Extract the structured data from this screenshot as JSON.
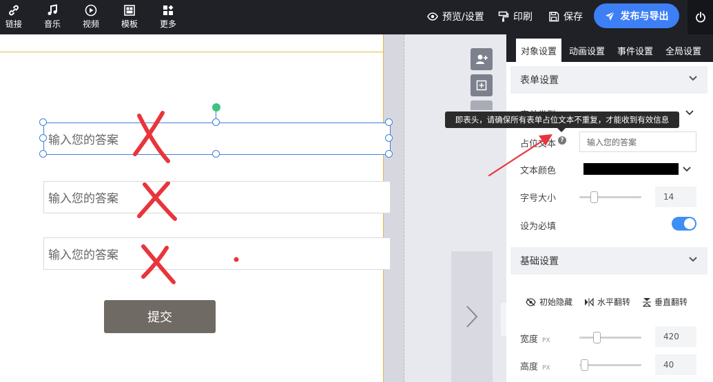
{
  "toolbar": {
    "tools": [
      {
        "label": "链接",
        "icon": "link-icon"
      },
      {
        "label": "音乐",
        "icon": "music-icon"
      },
      {
        "label": "视频",
        "icon": "video-icon"
      },
      {
        "label": "模板",
        "icon": "template-icon"
      },
      {
        "label": "更多",
        "icon": "more-icon"
      }
    ],
    "preview_label": "预览/设置",
    "print_label": "印刷",
    "save_label": "保存",
    "publish_label": "发布与导出"
  },
  "canvas": {
    "fields": [
      {
        "placeholder": "输入您的答案"
      },
      {
        "placeholder": "输入您的答案"
      },
      {
        "placeholder": "输入您的答案"
      }
    ],
    "submit_label": "提交"
  },
  "panel": {
    "tabs": [
      "对象设置",
      "动画设置",
      "事件设置",
      "全局设置"
    ],
    "form_section": {
      "title": "表单设置",
      "type_label": "表单类型",
      "placeholder_label": "占位文本",
      "placeholder_value": "输入您的答案",
      "text_color_label": "文本颜色",
      "text_color": "#000000",
      "font_size_label": "字号大小",
      "font_size_value": "14",
      "required_label": "设为必填",
      "required": true
    },
    "basic_section": {
      "title": "基础设置",
      "hide_label": "初始隐藏",
      "hflip_label": "水平翻转",
      "vflip_label": "垂直翻转",
      "width_label": "宽度",
      "width_unit": "PX",
      "width_value": "420",
      "height_label": "高度",
      "height_unit": "PX",
      "height_value": "40"
    }
  },
  "tooltip": "即表头，请确保所有表单占位文本不重复，才能收到有效信息",
  "colors": {
    "accent": "#3d7ff5",
    "toolbar_bg": "#1f2127",
    "annotation_red": "#e8353b",
    "selection_blue": "#3f7fd8"
  }
}
